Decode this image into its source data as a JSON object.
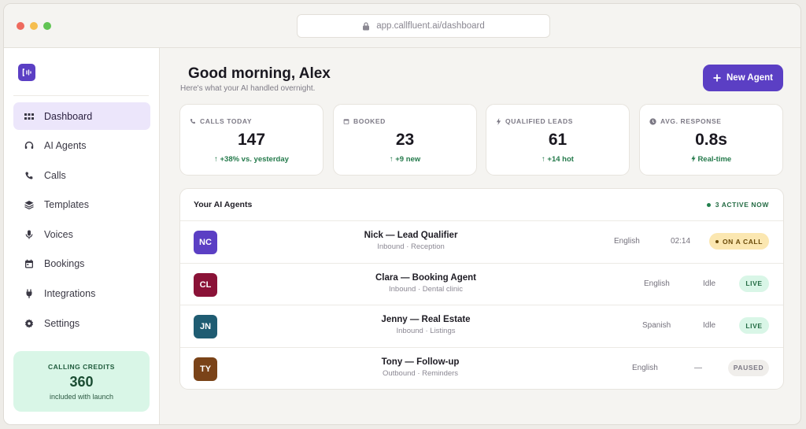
{
  "browser": {
    "url": "app.callfluent.ai/dashboard",
    "dot_colors": [
      "#ee6a5e",
      "#f5be4f",
      "#61c454"
    ]
  },
  "sidebar": {
    "items": [
      {
        "label": "Dashboard",
        "icon": "grid-icon",
        "active": true
      },
      {
        "label": "AI Agents",
        "icon": "headset-icon",
        "active": false
      },
      {
        "label": "Calls",
        "icon": "phone-icon",
        "active": false
      },
      {
        "label": "Templates",
        "icon": "layers-icon",
        "active": false
      },
      {
        "label": "Voices",
        "icon": "microphone-icon",
        "active": false
      },
      {
        "label": "Bookings",
        "icon": "calendar-icon",
        "active": false
      },
      {
        "label": "Integrations",
        "icon": "plug-icon",
        "active": false
      },
      {
        "label": "Settings",
        "icon": "gear-icon",
        "active": false
      }
    ],
    "credits": {
      "label": "CALLING CREDITS",
      "value": "360",
      "sub": "included with launch"
    }
  },
  "header": {
    "greeting": "Good morning, Alex",
    "subtitle": "Here's what your AI handled overnight.",
    "new_agent_label": "New Agent"
  },
  "stats": [
    {
      "label": "CALLS TODAY",
      "icon": "phone-icon",
      "value": "147",
      "delta": "↑ +38% vs. yesterday"
    },
    {
      "label": "BOOKED",
      "icon": "calendar-icon",
      "value": "23",
      "delta": "↑ +9 new"
    },
    {
      "label": "QUALIFIED LEADS",
      "icon": "bolt-icon",
      "value": "61",
      "delta": "↑ +14 hot"
    },
    {
      "label": "AVG. RESPONSE",
      "icon": "clock-icon",
      "value": "0.8s",
      "delta": "Real-time"
    }
  ],
  "agents": {
    "title": "Your AI Agents",
    "active_label": "3 ACTIVE NOW",
    "rows": [
      {
        "initials": "NC",
        "name": "Nick — Lead Qualifier",
        "meta": "Inbound · Reception",
        "language": "English",
        "time": "02:14",
        "status": "ON A CALL",
        "avatar_color": "#5b3fc4"
      },
      {
        "initials": "CL",
        "name": "Clara — Booking Agent",
        "meta": "Inbound · Dental clinic",
        "language": "English",
        "time": "Idle",
        "status": "LIVE",
        "avatar_color": "#8a1237"
      },
      {
        "initials": "JN",
        "name": "Jenny — Real Estate",
        "meta": "Inbound · Listings",
        "language": "Spanish",
        "time": "Idle",
        "status": "LIVE",
        "avatar_color": "#1f5c72"
      },
      {
        "initials": "TY",
        "name": "Tony — Follow-up",
        "meta": "Outbound · Reminders",
        "language": "English",
        "time": "—",
        "status": "PAUSED",
        "avatar_color": "#7a4318"
      }
    ]
  },
  "colors": {
    "accent": "#5b3fc4",
    "success": "#247a4b",
    "on_call_bg": "#fbe7b1",
    "live_bg": "#d9f6e7",
    "paused_bg": "#f0eeeb"
  }
}
